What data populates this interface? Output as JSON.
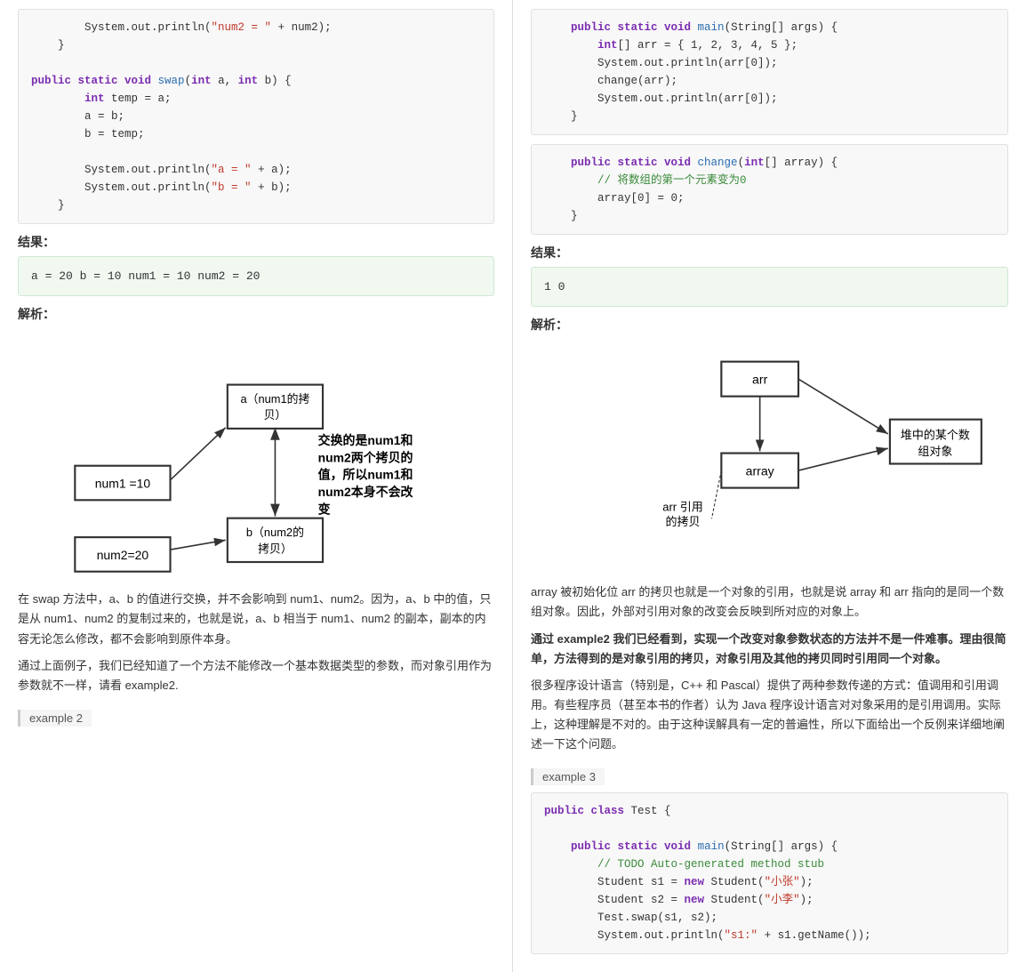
{
  "left": {
    "code_top": {
      "lines": [
        {
          "indent": 8,
          "text": "System.out.println(\"num2 = \" + num2);"
        },
        {
          "indent": 4,
          "text": "}"
        },
        {
          "indent": 0,
          "text": ""
        },
        {
          "indent": 0,
          "text": "public static void swap(int a, int b) {"
        },
        {
          "indent": 8,
          "text": "int temp = a;"
        },
        {
          "indent": 8,
          "text": "a = b;"
        },
        {
          "indent": 8,
          "text": "b = temp;"
        },
        {
          "indent": 0,
          "text": ""
        },
        {
          "indent": 8,
          "text": "System.out.println(\"a = \" + a);"
        },
        {
          "indent": 8,
          "text": "System.out.println(\"b = \" + b);"
        },
        {
          "indent": 4,
          "text": "}"
        }
      ]
    },
    "result_label": "结果：",
    "result_lines": [
      "a = 20",
      "b = 10",
      "num1 = 10",
      "num2 = 20"
    ],
    "analysis_label": "解析：",
    "diagram_note": "交换的是num1和\nnum2两个拷贝的\n值，所以num1和\nnum2本身不会改\n变",
    "boxes": {
      "num1": "num1 =10",
      "num2": "num2=20",
      "a_copy": "a（num1的拷\n贝）",
      "b_copy": "b（num2的\n拷贝）"
    },
    "analysis_text": "在 swap 方法中，a、b 的值进行交换，并不会影响到 num1、num2。因为，a、b 中的值，只是从 num1、num2 的复制过来的，也就是说，a、b 相当于 num1、num2 的副本，副本的内容无论怎么修改，都不会影响到原件本身。",
    "conclusion_text": "通过上面例子，我们已经知道了一个方法不能修改一个基本数据类型的参数，而对象引用作为参数就不一样，请看 example2.",
    "example_tag": "example 2"
  },
  "right": {
    "code_top": {
      "lines": [
        "public static void main(String[] args) {",
        "    int[] arr = { 1, 2, 3, 4, 5 };",
        "    System.out.println(arr[0]);",
        "    change(arr);",
        "    System.out.println(arr[0]);",
        "}"
      ]
    },
    "code_change": {
      "lines": [
        "public static void change(int[] array) {",
        "    // 将数组的第一个元素变为0",
        "    array[0] = 0;",
        "}"
      ]
    },
    "result_label": "结果：",
    "result_lines": [
      "1",
      "0"
    ],
    "analysis_label": "解析：",
    "analysis1": "array 被初始化位 arr 的拷贝也就是一个对象的引用，也就是说 array 和 arr 指向的是同一个数组对象。因此，外部对引用对象的改变会反映到所对应的对象上。",
    "analysis2": "通过 example2 我们已经看到，实现一个改变对象参数状态的方法并不是一件难事。理由很简单，方法得到的是对象引用的拷贝，对象引用及其他的拷贝同时引用同一个对象。",
    "analysis3": "很多程序设计语言（特别是，C++ 和 Pascal）提供了两种参数传递的方式：值调用和引用调用。有些程序员（甚至本书的作者）认为 Java 程序设计语言对对象采用的是引用调用。实际上，这种理解是不对的。由于这种误解具有一定的普遍性，所以下面给出一个反例来详细地阐述一下这个问题。",
    "example_tag": "example 3",
    "code_example3": {
      "lines": [
        "public class Test {",
        "",
        "    public static void main(String[] args) {",
        "        // TODO Auto-generated method stub",
        "        Student s1 = new Student(\"小张\");",
        "        Student s2 = new Student(\"小李\");",
        "        Test.swap(s1, s2);",
        "        System.out.println(\"s1:\" + s1.getName());"
      ]
    },
    "diagram": {
      "arr_box": "arr",
      "array_box": "array",
      "heap_box": "堆中的某个数\n组对象",
      "arr_copy_label": "arr 引用\n的拷贝"
    }
  }
}
